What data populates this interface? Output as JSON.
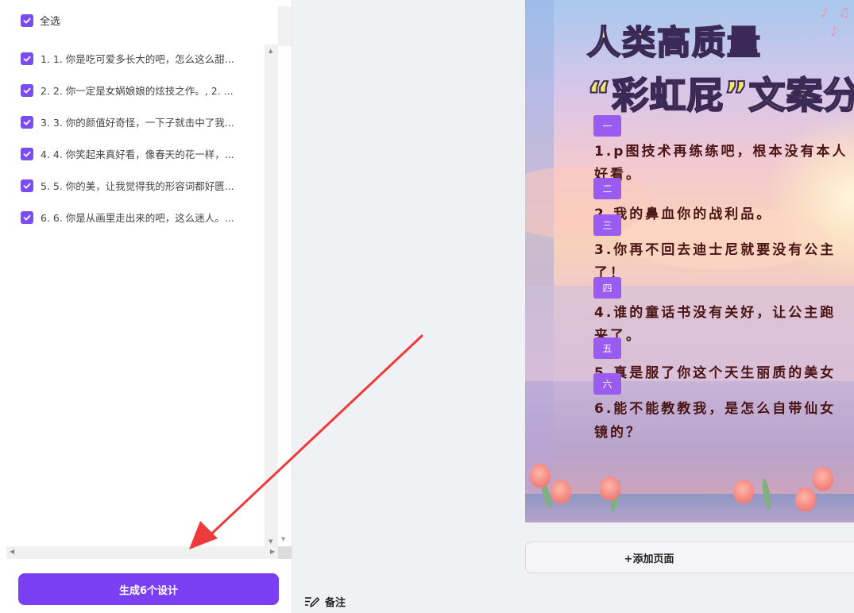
{
  "left_panel": {
    "select_all_label": "全选",
    "items": [
      {
        "label": "1. 1. 你是吃可爱多长大的吧，怎么这么甜..."
      },
      {
        "label": "2. 2. 你一定是女娲娘娘的炫技之作。, 2. ..."
      },
      {
        "label": "3. 3. 你的颜值好奇怪，一下子就击中了我..."
      },
      {
        "label": "4. 4. 你笑起来真好看，像春天的花一样，..."
      },
      {
        "label": "5. 5. 你的美，让我觉得我的形容词都好匮..."
      },
      {
        "label": "6. 6. 你是从画里走出来的吧，这么迷人。..."
      }
    ],
    "generate_button": "生成6个设计"
  },
  "notes_label": "备注",
  "add_page_label": "+添加页面",
  "design": {
    "title_part1": "人类",
    "title_part2": "高质量",
    "title2_open_quote": "“",
    "title2_main": "彩虹屁",
    "title2_close_quote": "”",
    "title2_tail": "文案分",
    "sections": [
      {
        "badge": "一",
        "lines": [
          "1.p图技术再练练吧，根本没有本人",
          "好看。"
        ]
      },
      {
        "badge": "二",
        "lines": [
          "2.我的鼻血你的战利品。"
        ]
      },
      {
        "badge": "三",
        "lines": [
          "3.你再不回去迪士尼就要没有公主",
          "了！"
        ]
      },
      {
        "badge": "四",
        "lines": [
          "4.谁的童话书没有关好，让公主跑",
          "来了。"
        ]
      },
      {
        "badge": "五",
        "lines": [
          "5.真是服了你这个天生丽质的美女"
        ]
      },
      {
        "badge": "六",
        "lines": [
          "6.能不能教教我，是怎么自带仙女",
          "镜的？"
        ]
      }
    ]
  },
  "colors": {
    "accent": "#7a3ff2",
    "checkbox": "#7b4cf0",
    "badge": "#9a5cf0",
    "annotation_arrow": "#ee3a3a"
  }
}
